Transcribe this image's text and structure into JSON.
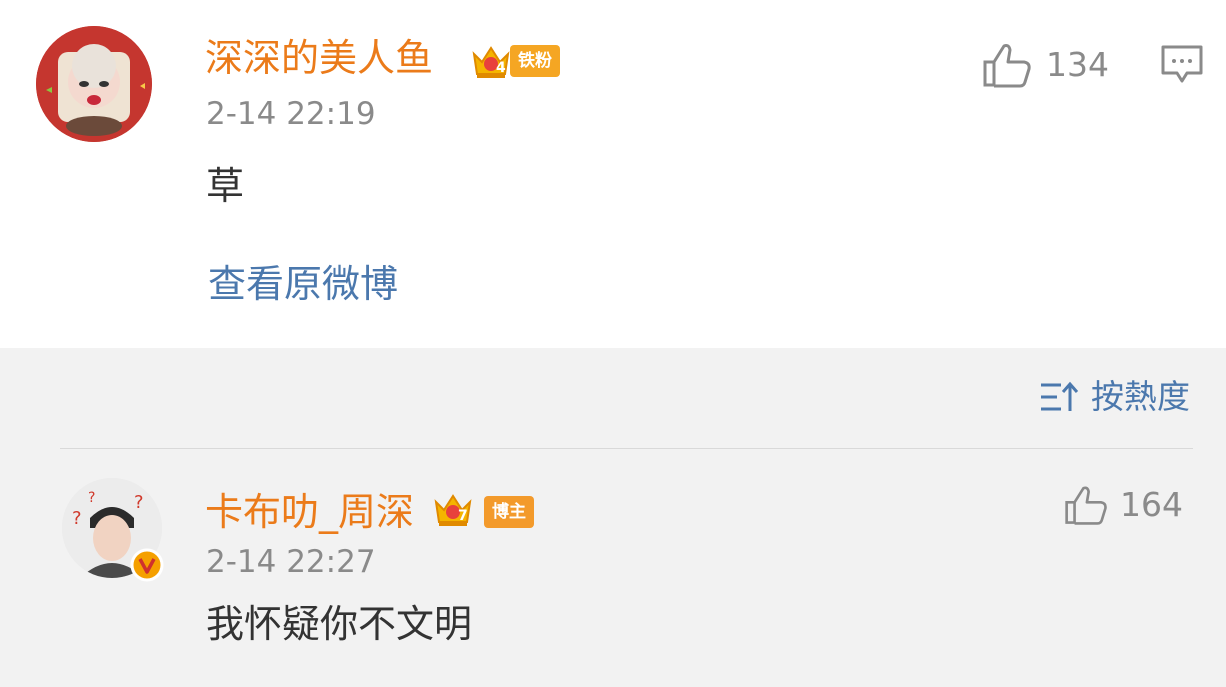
{
  "comment1": {
    "username": "深深的美人鱼",
    "level": "4",
    "badge": "铁粉",
    "time": "2-14 22:19",
    "text": "草",
    "like_count": "134",
    "view_original": "查看原微博"
  },
  "sort": {
    "label": "按熱度"
  },
  "comment2": {
    "username": "卡布叻_周深",
    "level": "7",
    "badge": "博主",
    "time": "2-14 22:27",
    "text": "我怀疑你不文明",
    "like_count": "164"
  },
  "colors": {
    "username": "#eb7b1a",
    "link": "#4b78ad",
    "muted": "#8a8a8a",
    "badge_orange": "#f5a623",
    "bg_section": "#f2f2f2"
  }
}
